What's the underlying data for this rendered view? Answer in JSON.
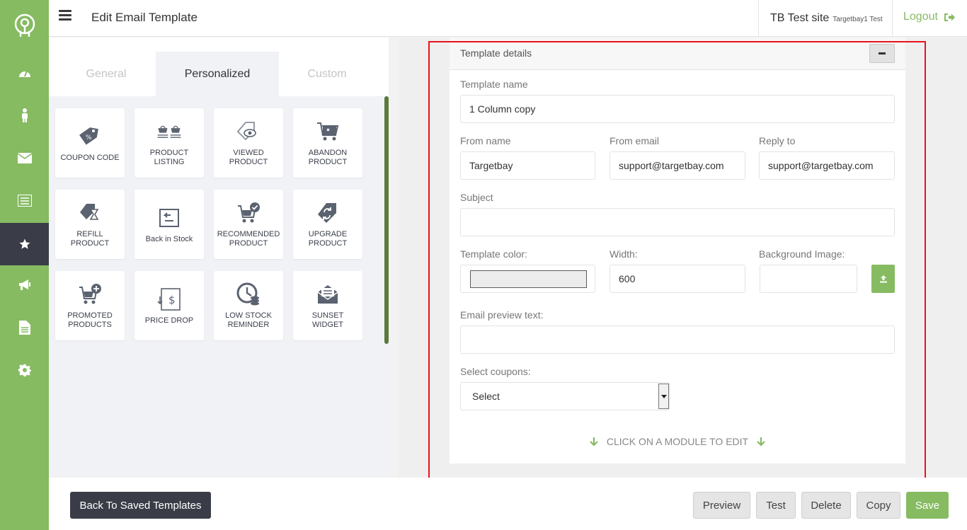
{
  "header": {
    "title": "Edit Email Template",
    "site_name": "TB Test site",
    "site_sub": "Targetbay1 Test",
    "logout_label": "Logout"
  },
  "sidebar": {
    "items": [
      {
        "name": "dashboard-icon"
      },
      {
        "name": "person-icon"
      },
      {
        "name": "mail-icon"
      },
      {
        "name": "list-icon"
      },
      {
        "name": "star-icon",
        "active": true
      },
      {
        "name": "megaphone-icon"
      },
      {
        "name": "document-icon"
      },
      {
        "name": "gear-icon"
      }
    ]
  },
  "tabs": [
    {
      "label": "General"
    },
    {
      "label": "Personalized",
      "active": true
    },
    {
      "label": "Custom"
    }
  ],
  "widgets": [
    {
      "label": "COUPON CODE",
      "icon": "coupon-tag-icon"
    },
    {
      "label": "PRODUCT LISTING",
      "icon": "product-baskets-icon"
    },
    {
      "label": "VIEWED PRODUCT",
      "icon": "viewed-tag-icon"
    },
    {
      "label": "ABANDON PRODUCT",
      "icon": "abandon-cart-icon"
    },
    {
      "label": "REFILL PRODUCT",
      "icon": "refill-hourglass-icon"
    },
    {
      "label": "Back in Stock",
      "icon": "back-in-stock-icon"
    },
    {
      "label": "RECOMMENDED PRODUCT",
      "icon": "recommended-cart-icon"
    },
    {
      "label": "UPGRADE PRODUCT",
      "icon": "upgrade-tag-icon"
    },
    {
      "label": "PROMOTED PRODUCTS",
      "icon": "promoted-cart-icon"
    },
    {
      "label": "PRICE DROP",
      "icon": "price-drop-icon"
    },
    {
      "label": "LOW STOCK REMINDER",
      "icon": "low-stock-clock-icon"
    },
    {
      "label": "SUNSET WIDGET",
      "icon": "sunset-envelope-icon"
    }
  ],
  "template_details": {
    "title": "Template details",
    "template_name_label": "Template name",
    "template_name_value": "1 Column copy",
    "from_name_label": "From name",
    "from_name_value": "Targetbay",
    "from_email_label": "From email",
    "from_email_value": "support@targetbay.com",
    "reply_to_label": "Reply to",
    "reply_to_value": "support@targetbay.com",
    "subject_label": "Subject",
    "subject_value": "",
    "template_color_label": "Template color:",
    "template_color_value": "#ececec",
    "width_label": "Width:",
    "width_value": "600",
    "bg_image_label": "Background Image:",
    "preview_text_label": "Email preview text:",
    "preview_text_value": "",
    "coupons_label": "Select coupons:",
    "coupons_selected": "Select",
    "hint": "CLICK ON A MODULE TO EDIT"
  },
  "footer": {
    "back_label": "Back To Saved Templates",
    "preview_label": "Preview",
    "test_label": "Test",
    "delete_label": "Delete",
    "copy_label": "Copy",
    "save_label": "Save"
  },
  "colors": {
    "accent": "#86bb62",
    "dark": "#3a3d47",
    "highlight": "#e8121c"
  }
}
